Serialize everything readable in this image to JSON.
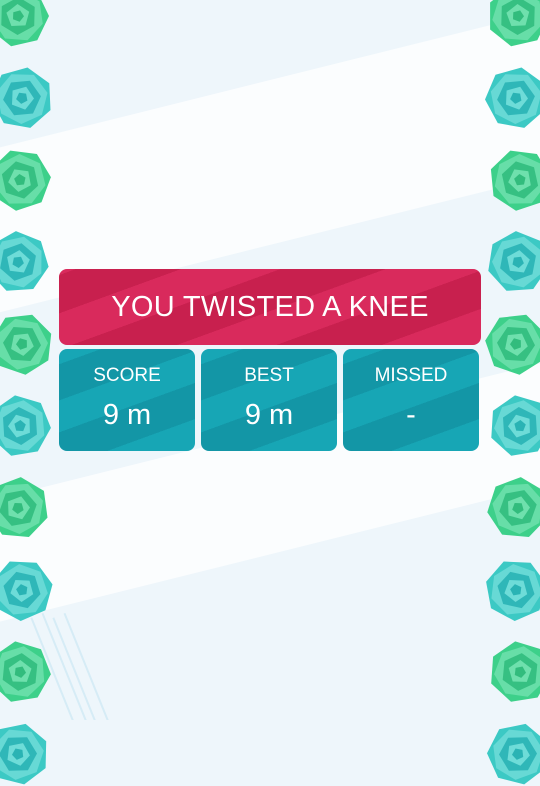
{
  "game": {
    "result_banner": "YOU TWISTED A KNEE",
    "stats": [
      {
        "label": "SCORE",
        "value": "9 m"
      },
      {
        "label": "BEST",
        "value": "9 m"
      },
      {
        "label": "MISSED",
        "value": "-"
      }
    ]
  },
  "colors": {
    "banner": "#d92a5c",
    "stat_card": "#17a6b5",
    "gem_teal": "#3cc9c4",
    "gem_green": "#3dd08a",
    "background": "#eef6fb"
  },
  "icons": {
    "wall_gem": "geometric-polygon-gem-icon"
  }
}
